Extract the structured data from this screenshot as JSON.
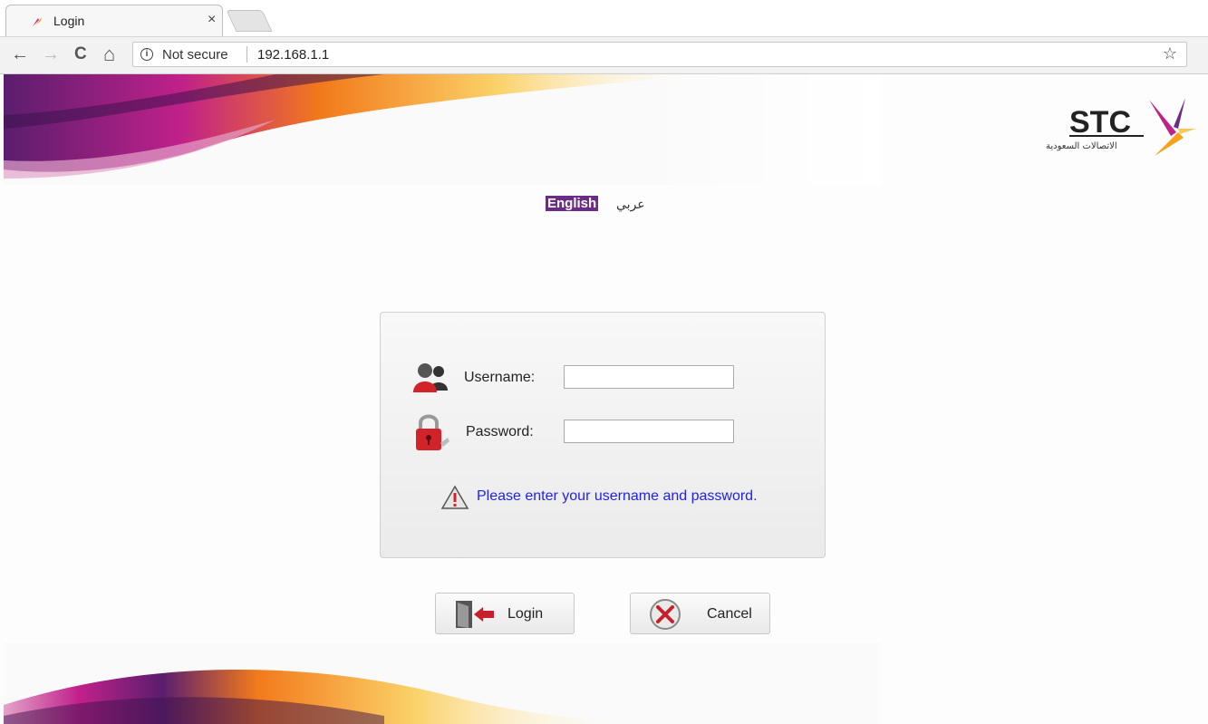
{
  "browser": {
    "tab_title": "Login",
    "tab_close": "×",
    "security_text": "Not secure",
    "url": "192.168.1.1",
    "back": "←",
    "forward": "→",
    "reload": "C",
    "home": "⌂",
    "star": "☆"
  },
  "brand": {
    "logo_text": "STC",
    "logo_subtext": "الاتصالات السعودية",
    "colors": {
      "purple": "#6b2c83",
      "orange": "#f7a21b",
      "magenta": "#c0208a"
    }
  },
  "language": {
    "english": "English",
    "arabic": "عربي"
  },
  "login": {
    "username_label": "Username:",
    "password_label": "Password:",
    "username_value": "",
    "password_value": "",
    "message": "Please enter your username and password.",
    "login_button": "Login",
    "cancel_button": "Cancel"
  },
  "icons": [
    "user-icon",
    "lock-icon",
    "warning-icon",
    "login-door-icon",
    "cancel-x-icon",
    "star-icon",
    "info-icon"
  ]
}
